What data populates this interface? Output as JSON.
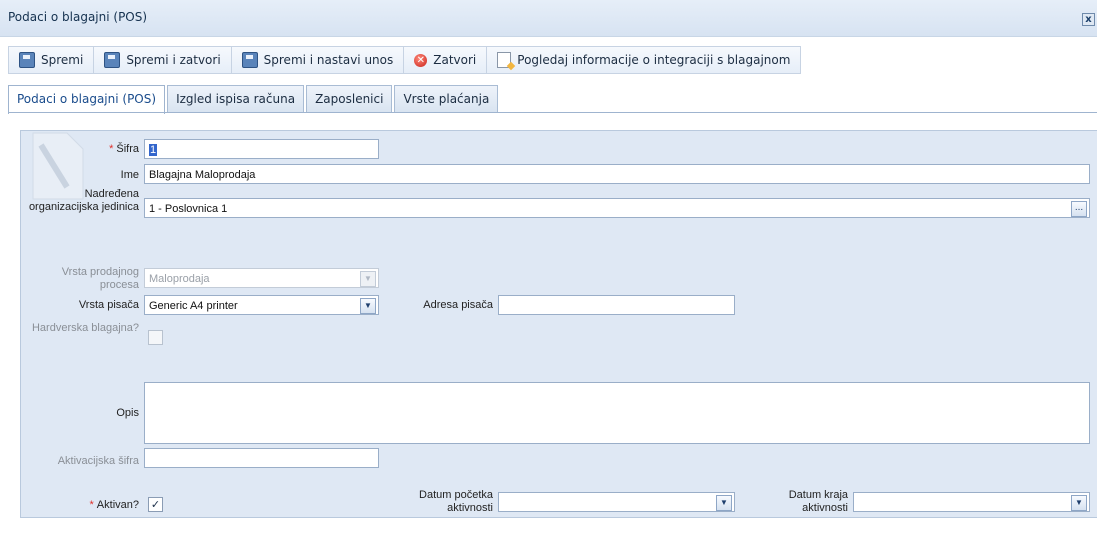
{
  "window": {
    "title": "Podaci o blagajni (POS)",
    "close_label": "x"
  },
  "toolbar": {
    "save": "Spremi",
    "save_close": "Spremi i zatvori",
    "save_continue": "Spremi i nastavi unos",
    "close": "Zatvori",
    "integration": "Pogledaj informacije o integraciji s blagajnom"
  },
  "tabs": [
    "Podaci o blagajni (POS)",
    "Izgled ispisa računa",
    "Zaposlenici",
    "Vrste plaćanja"
  ],
  "form": {
    "sifra": {
      "label": "Šifra",
      "value": "1",
      "required": true
    },
    "ime": {
      "label": "Ime",
      "value": "Blagajna  Maloprodaja"
    },
    "org": {
      "label": "Nadređena organizacijska jedinica",
      "value": "1 - Poslovnica 1",
      "button": "..."
    },
    "proces": {
      "label": "Vrsta prodajnog procesa",
      "value": "Maloprodaja",
      "disabled": true
    },
    "pisac": {
      "label": "Vrsta pisača",
      "value": "Generic A4 printer"
    },
    "adresa": {
      "label": "Adresa pisača",
      "value": ""
    },
    "hardverska": {
      "label": "Hardverska blagajna?",
      "checked": false,
      "disabled": true
    },
    "opis": {
      "label": "Opis",
      "value": ""
    },
    "aktivacijska": {
      "label": "Aktivacijska šifra",
      "value": "",
      "disabled": true
    },
    "aktivan": {
      "label": "Aktivan?",
      "checked": true,
      "required": true
    },
    "datum_pocetka": {
      "label": "Datum početka aktivnosti",
      "value": ""
    },
    "datum_kraja": {
      "label": "Datum kraja aktivnosti",
      "value": ""
    }
  },
  "icons": {
    "save": "floppy-disk-icon",
    "close": "red-x-circle-icon",
    "integration": "document-pencil-icon",
    "dropdown": "chevron-down-icon"
  },
  "colors": {
    "panel_bg": "#dfe8f4",
    "title_bg": "#dbe6f3",
    "required_star": "#e0302a",
    "active_tab_text": "#1a4c8c"
  }
}
